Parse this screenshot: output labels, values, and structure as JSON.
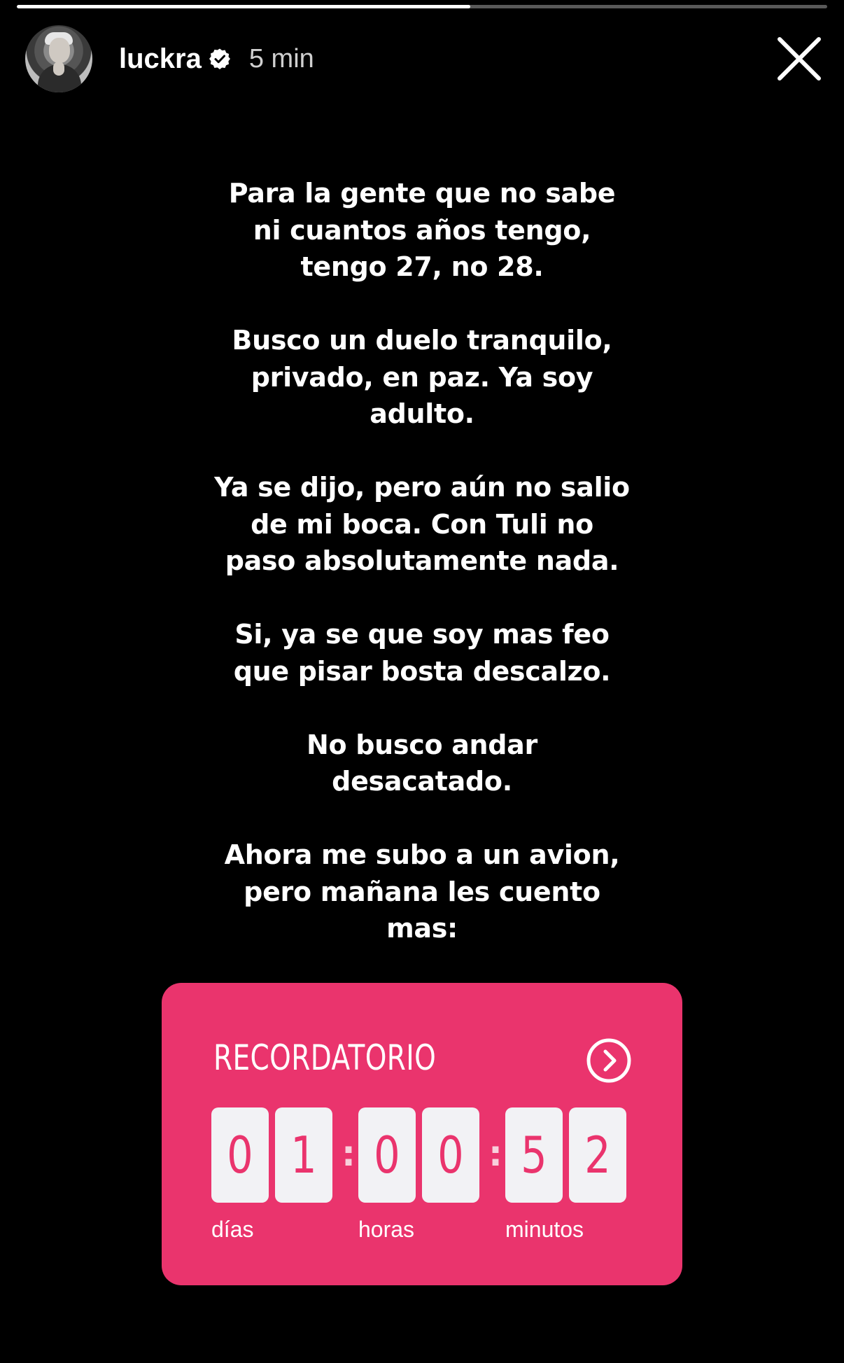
{
  "story": {
    "progress_fraction": 0.56,
    "username": "luckra",
    "verified": true,
    "timestamp": "5 min",
    "close_icon": "close-icon",
    "text_paragraphs": [
      [
        "Para la gente que no sabe",
        "ni cuantos años tengo,",
        "tengo 27, no 28."
      ],
      [
        "Busco un duelo tranquilo,",
        "privado, en paz. Ya soy",
        "adulto."
      ],
      [
        "Ya se dijo, pero aún no salio",
        "de mi boca. Con Tuli no",
        "paso absolutamente nada."
      ],
      [
        "Si, ya se que soy mas feo",
        "que pisar bosta descalzo."
      ],
      [
        "No busco andar",
        "desacatado."
      ],
      [
        "Ahora me subo a un avion,",
        "pero mañana les cuento",
        "mas:"
      ]
    ]
  },
  "reminder": {
    "title": "RECORDATORIO",
    "arrow_icon": "chevron-right-circle-icon",
    "background_color": "#ea346d",
    "days_digits": [
      "0",
      "1"
    ],
    "hours_digits": [
      "0",
      "0"
    ],
    "minutes_digits": [
      "5",
      "2"
    ],
    "units": {
      "days": "días",
      "hours": "horas",
      "minutes": "minutos"
    }
  }
}
